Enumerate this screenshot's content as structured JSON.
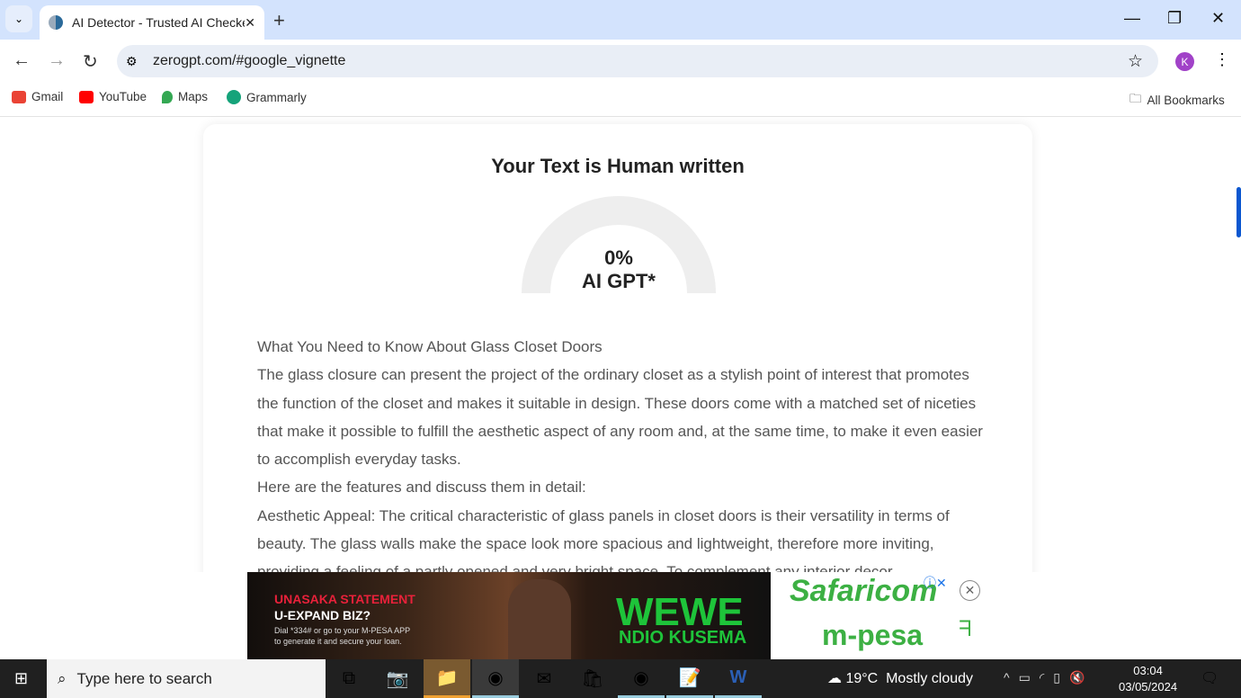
{
  "browser": {
    "tab_title": "AI Detector - Trusted AI Checker",
    "url": "zerogpt.com/#google_vignette",
    "profile_initial": "K",
    "bookmarks": [
      {
        "label": "Gmail",
        "icon": "gmail-icon",
        "color": "#ea4335"
      },
      {
        "label": "YouTube",
        "icon": "youtube-icon",
        "color": "#ff0000"
      },
      {
        "label": "Maps",
        "icon": "maps-icon",
        "color": "#34a853"
      },
      {
        "label": "Grammarly",
        "icon": "grammarly-icon",
        "color": "#15c39a"
      }
    ],
    "all_bookmarks": "All Bookmarks"
  },
  "result": {
    "title": "Your Text is Human written",
    "percent": "0%",
    "label": "AI GPT*",
    "ai_fraction": 0,
    "gauge_color": "#eeeeee"
  },
  "text_lines": [
    "What You Need to Know About Glass Closet Doors",
    "The glass closure can present the project of the ordinary closet as a stylish point of interest that promotes the function of the closet and makes it suitable in design. These doors come with a matched set of niceties that make it possible to fulfill the aesthetic aspect of any room and, at the same time, to make it even easier to accomplish everyday tasks.",
    "Here are the features and discuss them in detail:",
    "Aesthetic Appeal: The critical characteristic of glass panels in closet doors is their versatility in terms of beauty. The glass walls make the space look more spacious and lightweight, therefore more inviting, providing a feeling of a partly opened and very bright space. To complement any interior decor,"
  ],
  "ad": {
    "line1": "UNASAKA STATEMENT",
    "line2": "U-EXPAND BIZ?",
    "line3": "Dial *334# or go to your M-PESA APP",
    "line4": "to generate it and secure your loan.",
    "slogan1": "WEWE",
    "slogan2": "NDIO KUSEMA",
    "brand1": "Safaricom",
    "brand2": "m-pesa"
  },
  "taskbar": {
    "search_placeholder": "Type here to search",
    "temperature": "19°C",
    "weather": "Mostly cloudy",
    "time": "03:04",
    "date": "03/05/2024"
  }
}
